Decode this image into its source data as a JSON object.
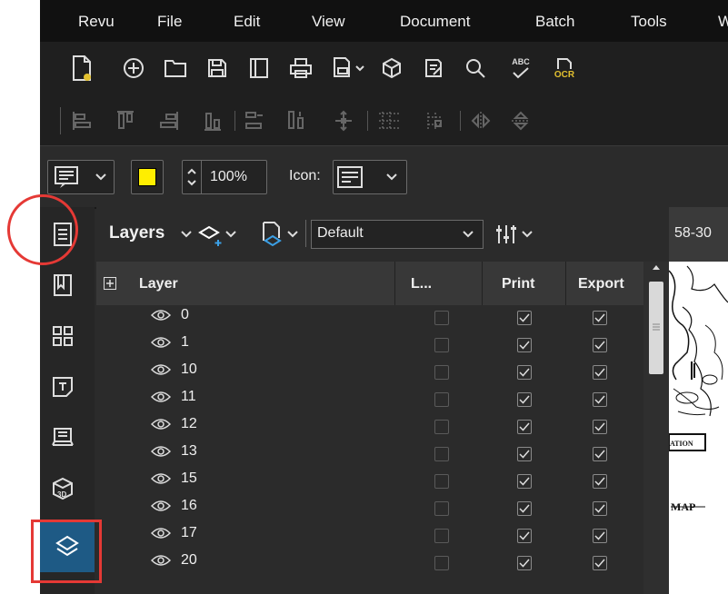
{
  "menubar": {
    "items": [
      "Revu",
      "File",
      "Edit",
      "View",
      "Document",
      "Batch",
      "Tools",
      "W"
    ]
  },
  "toolbar1": {
    "icons": [
      "new-file-icon",
      "add-circle-icon",
      "open-folder-icon",
      "save-icon",
      "document-icon",
      "print-icon",
      "page-setup-icon",
      "3d-box-icon",
      "edit-form-icon",
      "search-icon",
      "spellcheck-icon",
      "ocr-icon"
    ],
    "spellcheck_label": "ABC",
    "ocr_label": "OCR"
  },
  "toolbar2": {
    "icons": [
      "align-left-icon",
      "align-top-icon",
      "align-right-icon",
      "align-bottom-icon",
      "distribute-horizontal-icon",
      "distribute-vertical-icon",
      "center-icon",
      "grid-icon",
      "snap-icon",
      "flip-horizontal-icon",
      "flip-vertical-icon"
    ]
  },
  "properties": {
    "zoom": "100%",
    "icon_label": "Icon:",
    "fill_color": "#ffee00"
  },
  "panel": {
    "title": "Layers",
    "preset": "Default",
    "doc_tab": "58-30"
  },
  "columns": {
    "layer": "Layer",
    "lock": "L...",
    "print": "Print",
    "export": "Export"
  },
  "layers": [
    {
      "name": "0",
      "lock": false,
      "print": true,
      "export": true
    },
    {
      "name": "1",
      "lock": false,
      "print": true,
      "export": true
    },
    {
      "name": "10",
      "lock": false,
      "print": true,
      "export": true
    },
    {
      "name": "11",
      "lock": false,
      "print": true,
      "export": true
    },
    {
      "name": "12",
      "lock": false,
      "print": true,
      "export": true
    },
    {
      "name": "13",
      "lock": false,
      "print": true,
      "export": true
    },
    {
      "name": "15",
      "lock": false,
      "print": true,
      "export": true
    },
    {
      "name": "16",
      "lock": false,
      "print": true,
      "export": true
    },
    {
      "name": "17",
      "lock": false,
      "print": true,
      "export": true
    },
    {
      "name": "20",
      "lock": false,
      "print": true,
      "export": true
    }
  ],
  "doc_labels": {
    "label1": "ATION",
    "label2": "MAP"
  },
  "sidebar": {
    "items": [
      "properties-icon",
      "bookmarks-icon",
      "thumbnails-icon",
      "file-access-icon",
      "studio-icon",
      "3d-model-icon",
      "layers-icon"
    ]
  },
  "colors": {
    "accent": "#1e5a85",
    "highlight_annotation": "#e53935"
  }
}
